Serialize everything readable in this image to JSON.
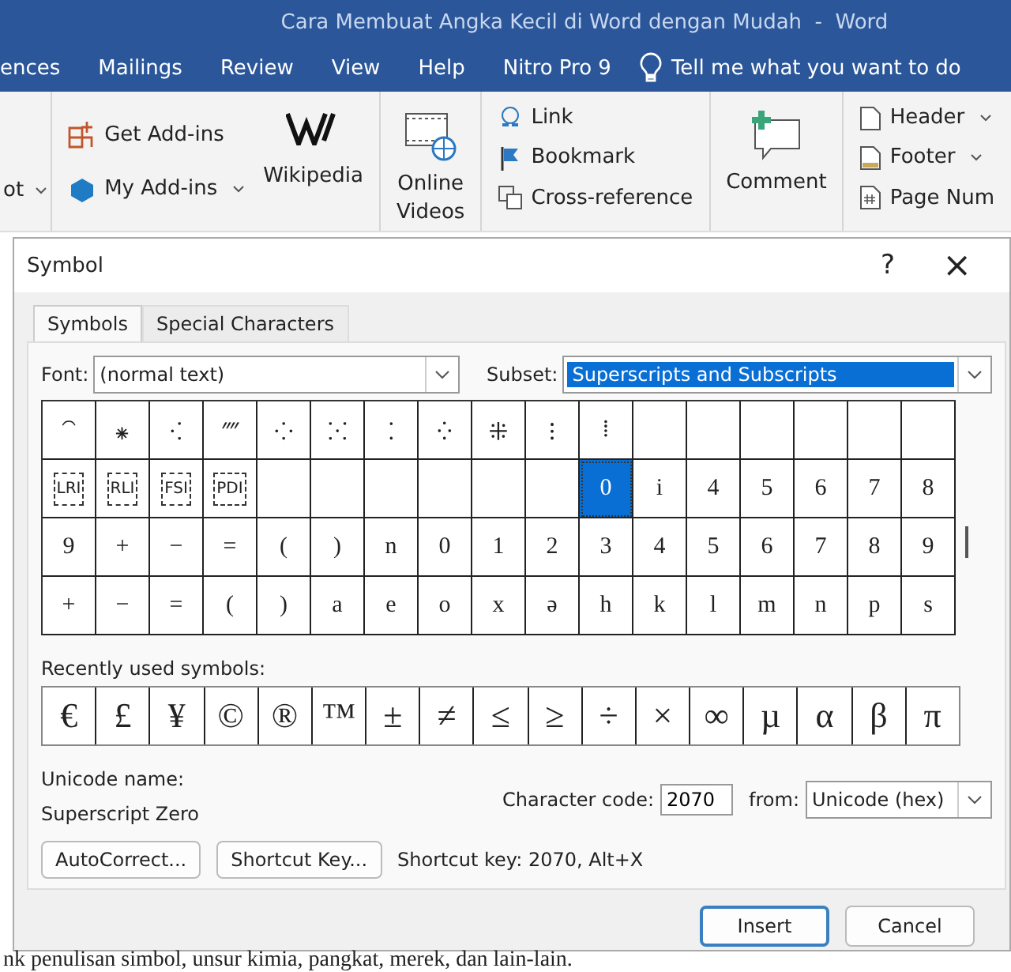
{
  "window": {
    "title": "Cara Membuat Angka Kecil di Word dengan Mudah  -  Word"
  },
  "ribbon_tabs": [
    {
      "label": "ences"
    },
    {
      "label": "Mailings"
    },
    {
      "label": "Review"
    },
    {
      "label": "View"
    },
    {
      "label": "Help"
    },
    {
      "label": "Nitro Pro 9"
    }
  ],
  "tell_me": "Tell me what you want to do",
  "ribbon": {
    "left_fragment": "ot",
    "get_addins": "Get Add-ins",
    "my_addins": "My Add-ins",
    "wikipedia": "Wikipedia",
    "online_videos": [
      "Online",
      "Videos"
    ],
    "link": "Link",
    "bookmark": "Bookmark",
    "cross_reference": "Cross-reference",
    "comment": "Comment",
    "header": "Header",
    "footer": "Footer",
    "page_number": "Page Num"
  },
  "dialog": {
    "title": "Symbol",
    "help": "?",
    "close": "×",
    "tabs": [
      {
        "label": "Symbols",
        "selected": true
      },
      {
        "label": "Special Characters",
        "selected": false
      }
    ],
    "font_label": "Font:",
    "font_value": "(normal text)",
    "subset_label": "Subset:",
    "subset_value": "Superscripts and Subscripts",
    "grid": [
      [
        {
          "kind": "glyph",
          "char": "⁀",
          "selected": false
        },
        {
          "kind": "glyph",
          "char": "⁕",
          "selected": false
        },
        {
          "kind": "glyph",
          "char": "⁖",
          "selected": false
        },
        {
          "kind": "glyph",
          "char": "⁗",
          "selected": false
        },
        {
          "kind": "glyph",
          "char": "⁘",
          "selected": false
        },
        {
          "kind": "glyph",
          "char": "⁙",
          "selected": false
        },
        {
          "kind": "glyph",
          "char": "⁚",
          "selected": false
        },
        {
          "kind": "glyph",
          "char": "⁛",
          "selected": false
        },
        {
          "kind": "glyph",
          "char": "⁜",
          "selected": false
        },
        {
          "kind": "glyph",
          "char": "⁝",
          "selected": false
        },
        {
          "kind": "glyph",
          "char": "⁞",
          "selected": false
        },
        {
          "kind": "empty",
          "selected": false
        },
        {
          "kind": "empty",
          "selected": false
        },
        {
          "kind": "empty",
          "selected": false
        },
        {
          "kind": "empty",
          "selected": false
        },
        {
          "kind": "empty",
          "selected": false
        },
        {
          "kind": "empty",
          "selected": false
        }
      ],
      [
        {
          "kind": "boxed",
          "char": "LRI",
          "selected": false
        },
        {
          "kind": "boxed",
          "char": "RLI",
          "selected": false
        },
        {
          "kind": "boxed",
          "char": "FSI",
          "selected": false
        },
        {
          "kind": "boxed",
          "char": "PDI",
          "selected": false
        },
        {
          "kind": "empty",
          "selected": false
        },
        {
          "kind": "empty",
          "selected": false
        },
        {
          "kind": "empty",
          "selected": false
        },
        {
          "kind": "empty",
          "selected": false
        },
        {
          "kind": "empty",
          "selected": false
        },
        {
          "kind": "empty",
          "selected": false
        },
        {
          "kind": "glyph",
          "char": "0",
          "selected": true
        },
        {
          "kind": "glyph",
          "char": "i",
          "selected": false
        },
        {
          "kind": "glyph",
          "char": "4",
          "selected": false
        },
        {
          "kind": "glyph",
          "char": "5",
          "selected": false
        },
        {
          "kind": "glyph",
          "char": "6",
          "selected": false
        },
        {
          "kind": "glyph",
          "char": "7",
          "selected": false
        },
        {
          "kind": "glyph",
          "char": "8",
          "selected": false
        }
      ],
      [
        {
          "kind": "glyph",
          "char": "9",
          "selected": false
        },
        {
          "kind": "glyph",
          "char": "+",
          "selected": false
        },
        {
          "kind": "glyph",
          "char": "−",
          "selected": false
        },
        {
          "kind": "glyph",
          "char": "=",
          "selected": false
        },
        {
          "kind": "glyph",
          "char": "(",
          "selected": false
        },
        {
          "kind": "glyph",
          "char": ")",
          "selected": false
        },
        {
          "kind": "glyph",
          "char": "n",
          "selected": false
        },
        {
          "kind": "glyph",
          "char": "0",
          "selected": false
        },
        {
          "kind": "glyph",
          "char": "1",
          "selected": false
        },
        {
          "kind": "glyph",
          "char": "2",
          "selected": false
        },
        {
          "kind": "glyph",
          "char": "3",
          "selected": false
        },
        {
          "kind": "glyph",
          "char": "4",
          "selected": false
        },
        {
          "kind": "glyph",
          "char": "5",
          "selected": false
        },
        {
          "kind": "glyph",
          "char": "6",
          "selected": false
        },
        {
          "kind": "glyph",
          "char": "7",
          "selected": false
        },
        {
          "kind": "glyph",
          "char": "8",
          "selected": false
        },
        {
          "kind": "glyph",
          "char": "9",
          "selected": false
        }
      ],
      [
        {
          "kind": "glyph",
          "char": "+",
          "selected": false
        },
        {
          "kind": "glyph",
          "char": "−",
          "selected": false
        },
        {
          "kind": "glyph",
          "char": "=",
          "selected": false
        },
        {
          "kind": "glyph",
          "char": "(",
          "selected": false
        },
        {
          "kind": "glyph",
          "char": ")",
          "selected": false
        },
        {
          "kind": "glyph",
          "char": "a",
          "selected": false
        },
        {
          "kind": "glyph",
          "char": "e",
          "selected": false
        },
        {
          "kind": "glyph",
          "char": "o",
          "selected": false
        },
        {
          "kind": "glyph",
          "char": "x",
          "selected": false
        },
        {
          "kind": "glyph",
          "char": "ə",
          "selected": false
        },
        {
          "kind": "glyph",
          "char": "h",
          "selected": false
        },
        {
          "kind": "glyph",
          "char": "k",
          "selected": false
        },
        {
          "kind": "glyph",
          "char": "l",
          "selected": false
        },
        {
          "kind": "glyph",
          "char": "m",
          "selected": false
        },
        {
          "kind": "glyph",
          "char": "n",
          "selected": false
        },
        {
          "kind": "glyph",
          "char": "p",
          "selected": false
        },
        {
          "kind": "glyph",
          "char": "s",
          "selected": false
        }
      ]
    ],
    "recent_label": "Recently used symbols:",
    "recent": [
      "€",
      "£",
      "¥",
      "©",
      "®",
      "™",
      "±",
      "≠",
      "≤",
      "≥",
      "÷",
      "×",
      "∞",
      "µ",
      "α",
      "β",
      "π"
    ],
    "unicode_name_label": "Unicode name:",
    "unicode_name": "Superscript Zero",
    "char_code_label": "Character code:",
    "char_code": "2070",
    "from_label": "from:",
    "from_value": "Unicode (hex)",
    "autocorrect": "AutoCorrect...",
    "shortcut_key_button": "Shortcut Key...",
    "shortcut_info": "Shortcut key: 2070, Alt+X",
    "insert": "Insert",
    "cancel": "Cancel"
  },
  "document_text": "nk penulisan simbol, unsur kimia, pangkat, merek, dan lain-lain."
}
